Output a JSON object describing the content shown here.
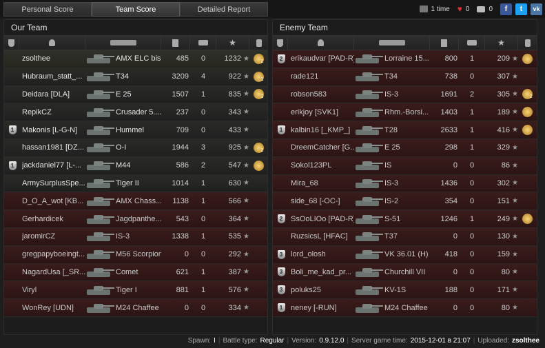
{
  "tabs": [
    {
      "label": "Personal Score",
      "active": false
    },
    {
      "label": "Team Score",
      "active": true
    },
    {
      "label": "Detailed Report",
      "active": false
    }
  ],
  "top_stats": {
    "times": "1 time",
    "likes": "0",
    "comments": "0",
    "social": [
      "f",
      "t",
      "vk"
    ]
  },
  "colors": {
    "accent": "#e8e8e8",
    "dead_row": "#3a1c1c",
    "facebook": "#3b5998",
    "twitter": "#1da1f2",
    "vk": "#4c75a3",
    "heart": "#d33"
  },
  "our_team": {
    "title": "Our Team",
    "players": [
      {
        "name": "zsolthee",
        "tank": "AMX ELC bis",
        "damage": "485",
        "frags": "0",
        "xp": "1232",
        "badge": "",
        "medal": "2",
        "status": "self"
      },
      {
        "name": "Hubraum_statt_...",
        "tank": "T34",
        "damage": "3209",
        "frags": "4",
        "xp": "922",
        "badge": "",
        "medal": "1",
        "status": "alive"
      },
      {
        "name": "Deidara [DLA]",
        "tank": "E 25",
        "damage": "1507",
        "frags": "1",
        "xp": "835",
        "badge": "",
        "medal": "3",
        "status": "alive"
      },
      {
        "name": "RepikCZ",
        "tank": "Crusader 5....",
        "damage": "237",
        "frags": "0",
        "xp": "343",
        "badge": "",
        "medal": "",
        "status": "alive"
      },
      {
        "name": "Makonis [L-G-N]",
        "tank": "Hummel",
        "damage": "709",
        "frags": "0",
        "xp": "433",
        "badge": "1",
        "medal": "",
        "status": "alive"
      },
      {
        "name": "hassan1981 [DZ...",
        "tank": "O-I",
        "damage": "1944",
        "frags": "3",
        "xp": "925",
        "badge": "",
        "medal": "2",
        "status": "alive"
      },
      {
        "name": "jackdaniel77 [L-...",
        "tank": "M44",
        "damage": "586",
        "frags": "2",
        "xp": "547",
        "badge": "1",
        "medal": "x",
        "status": "alive"
      },
      {
        "name": "ArmySurplusSpe...",
        "tank": "Tiger II",
        "damage": "1014",
        "frags": "1",
        "xp": "630",
        "badge": "",
        "medal": "",
        "status": "alive"
      },
      {
        "name": "D_O_A_wot [KB...",
        "tank": "AMX Chass...",
        "damage": "1138",
        "frags": "1",
        "xp": "566",
        "badge": "",
        "medal": "",
        "status": "dead"
      },
      {
        "name": "Gerhardicek",
        "tank": "Jagdpanthe...",
        "damage": "543",
        "frags": "0",
        "xp": "364",
        "badge": "",
        "medal": "",
        "status": "dead"
      },
      {
        "name": "jaromirCZ",
        "tank": "IS-3",
        "damage": "1338",
        "frags": "1",
        "xp": "535",
        "badge": "",
        "medal": "",
        "status": "dead"
      },
      {
        "name": "gregpapyboeingt...",
        "tank": "M56 Scorpion",
        "damage": "0",
        "frags": "0",
        "xp": "292",
        "badge": "",
        "medal": "",
        "status": "dead"
      },
      {
        "name": "NagardUsa [_SR...",
        "tank": "Comet",
        "damage": "621",
        "frags": "1",
        "xp": "387",
        "badge": "",
        "medal": "",
        "status": "dead"
      },
      {
        "name": "Viryl",
        "tank": "Tiger I",
        "damage": "881",
        "frags": "1",
        "xp": "576",
        "badge": "",
        "medal": "",
        "status": "dead"
      },
      {
        "name": "WonRey [UDN]",
        "tank": "M24 Chaffee",
        "damage": "0",
        "frags": "0",
        "xp": "334",
        "badge": "",
        "medal": "",
        "status": "dead"
      }
    ]
  },
  "enemy_team": {
    "title": "Enemy Team",
    "players": [
      {
        "name": "erikaudvar [PAD-R]",
        "tank": "Lorraine 15...",
        "damage": "800",
        "frags": "1",
        "xp": "209",
        "badge": "2",
        "medal": "x",
        "status": "dead"
      },
      {
        "name": "rade121",
        "tank": "T34",
        "damage": "738",
        "frags": "0",
        "xp": "307",
        "badge": "",
        "medal": "",
        "status": "dead"
      },
      {
        "name": "robson583",
        "tank": "IS-3",
        "damage": "1691",
        "frags": "2",
        "xp": "305",
        "badge": "",
        "medal": "2",
        "status": "dead"
      },
      {
        "name": "erikjoy [SVK1]",
        "tank": "Rhm.-Borsi...",
        "damage": "1403",
        "frags": "1",
        "xp": "189",
        "badge": "",
        "medal": "x",
        "status": "dead"
      },
      {
        "name": "kalbin16 [_KMP_]",
        "tank": "T28",
        "damage": "2633",
        "frags": "1",
        "xp": "416",
        "badge": "1",
        "medal": "x",
        "status": "dead"
      },
      {
        "name": "DreemCatcher [G...",
        "tank": "E 25",
        "damage": "298",
        "frags": "1",
        "xp": "329",
        "badge": "",
        "medal": "",
        "status": "dead"
      },
      {
        "name": "Sokol123PL",
        "tank": "IS",
        "damage": "0",
        "frags": "0",
        "xp": "86",
        "badge": "",
        "medal": "",
        "status": "dead"
      },
      {
        "name": "Mira_68",
        "tank": "IS-3",
        "damage": "1436",
        "frags": "0",
        "xp": "302",
        "badge": "",
        "medal": "",
        "status": "dead"
      },
      {
        "name": "side_68 [-OC-]",
        "tank": "IS-2",
        "damage": "354",
        "frags": "0",
        "xp": "151",
        "badge": "",
        "medal": "",
        "status": "dead"
      },
      {
        "name": "SsOoLIOo [PAD-R]",
        "tank": "S-51",
        "damage": "1246",
        "frags": "1",
        "xp": "249",
        "badge": "2",
        "medal": "x",
        "status": "dead"
      },
      {
        "name": "RuzsicsL [HFAC]",
        "tank": "T37",
        "damage": "0",
        "frags": "0",
        "xp": "130",
        "badge": "",
        "medal": "",
        "status": "dead"
      },
      {
        "name": "lord_olosh",
        "tank": "VK 36.01 (H)",
        "damage": "418",
        "frags": "0",
        "xp": "159",
        "badge": "3",
        "medal": "",
        "status": "dead"
      },
      {
        "name": "Boli_me_kad_pr...",
        "tank": "Churchill VII",
        "damage": "0",
        "frags": "0",
        "xp": "80",
        "badge": "3",
        "medal": "",
        "status": "dead"
      },
      {
        "name": "poluks25",
        "tank": "KV-1S",
        "damage": "188",
        "frags": "0",
        "xp": "171",
        "badge": "3",
        "medal": "",
        "status": "dead"
      },
      {
        "name": "neney [-RUN]",
        "tank": "M24 Chaffee",
        "damage": "0",
        "frags": "0",
        "xp": "80",
        "badge": "1",
        "medal": "",
        "status": "dead"
      }
    ]
  },
  "footer": {
    "spawn_label": "Spawn:",
    "spawn_value": "I",
    "battle_type_label": "Battle type:",
    "battle_type_value": "Regular",
    "version_label": "Version:",
    "version_value": "0.9.12.0",
    "server_time_label": "Server game time:",
    "server_time_value": "2015-12-01 в 21:07",
    "uploaded_label": "Uploaded:",
    "uploaded_value": "zsolthee"
  }
}
